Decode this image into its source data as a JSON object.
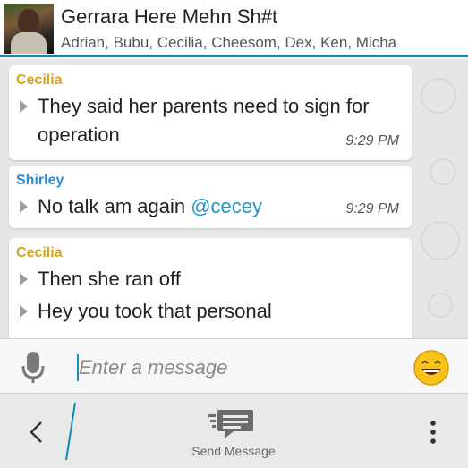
{
  "header": {
    "title": "Gerrara Here Mehn Sh#t",
    "members": "Adrian, Bubu, Cecilia, Cheesom, Dex, Ken, Micha"
  },
  "messages": [
    {
      "sender": "Cecilia",
      "lines": [
        "They said her parents need to sign for",
        "operation"
      ],
      "time": "9:29 PM"
    },
    {
      "sender": "Shirley",
      "text": "No talk am again",
      "mention": "@cecey",
      "time": "9:29 PM"
    },
    {
      "sender": "Cecilia",
      "lines": [
        "Then she ran off",
        "Hey you took that personal"
      ]
    }
  ],
  "composer": {
    "placeholder": "Enter a message",
    "mic_icon": "microphone-icon",
    "emoji_icon": "smiley-emoji-icon"
  },
  "action_bar": {
    "send_label": "Send Message",
    "back_icon": "chevron-left-icon",
    "send_icon": "send-message-icon",
    "overflow_icon": "vertical-dots-icon"
  },
  "colors": {
    "accent": "#0b8abf",
    "cecilia_name": "#d6a51c",
    "shirley_name": "#2d8bd0",
    "mention": "#2196c8",
    "emoji_face": "#f6c31a"
  }
}
